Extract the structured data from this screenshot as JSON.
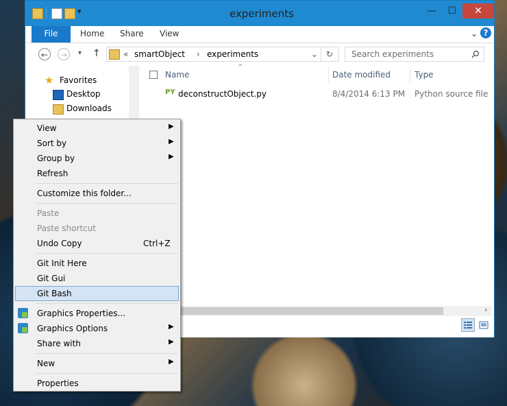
{
  "window": {
    "title": "experiments",
    "controls": {
      "minimize": "—",
      "maximize": "☐",
      "close": "✕"
    }
  },
  "ribbon": {
    "tabs": [
      "File",
      "Home",
      "Share",
      "View"
    ],
    "expand_chevron": "⌄",
    "help": "?"
  },
  "nav": {
    "back": "←",
    "forward": "→",
    "recent": "▾",
    "up": "↑",
    "breadcrumb_overflow": "«",
    "path": [
      "smartObject",
      "experiments"
    ],
    "separator": "›",
    "dropdown": "⌄",
    "refresh": "↻",
    "search_placeholder": "Search experiments",
    "search_icon": "search-icon"
  },
  "navpane": {
    "items": [
      {
        "label": "Favorites",
        "icon": "star-icon"
      },
      {
        "label": "Desktop",
        "icon": "desktop-icon"
      },
      {
        "label": "Downloads",
        "icon": "downloads-folder-icon"
      }
    ]
  },
  "filelist": {
    "columns": [
      "Name",
      "Date modified",
      "Type"
    ],
    "sort_indicator": "^",
    "rows": [
      {
        "badge": "PY",
        "name": "deconstructObject.py",
        "date": "8/4/2014 6:13 PM",
        "type": "Python source file"
      }
    ],
    "scroll_right": "›"
  },
  "context_menu": {
    "items": [
      {
        "label": "View",
        "submenu": true
      },
      {
        "label": "Sort by",
        "submenu": true
      },
      {
        "label": "Group by",
        "submenu": true
      },
      {
        "label": "Refresh"
      },
      {
        "label": "Customize this folder..."
      },
      {
        "label": "Paste",
        "disabled": true
      },
      {
        "label": "Paste shortcut",
        "disabled": true
      },
      {
        "label": "Undo Copy",
        "shortcut": "Ctrl+Z"
      },
      {
        "label": "Git Init Here"
      },
      {
        "label": "Git Gui"
      },
      {
        "label": "Git Bash",
        "highlighted": true
      },
      {
        "label": "Graphics Properties...",
        "icon": "intel-graphics-icon"
      },
      {
        "label": "Graphics Options",
        "icon": "intel-graphics-icon",
        "submenu": true
      },
      {
        "label": "Share with",
        "submenu": true
      },
      {
        "label": "New",
        "submenu": true
      },
      {
        "label": "Properties"
      }
    ],
    "submenu_arrow": "▶"
  },
  "colors": {
    "window_border": "#1f8ad2",
    "file_tab": "#1979ca",
    "close_button": "#c7463d",
    "menu_highlight": "#d5e4f4",
    "column_header_text": "#4c607a"
  }
}
